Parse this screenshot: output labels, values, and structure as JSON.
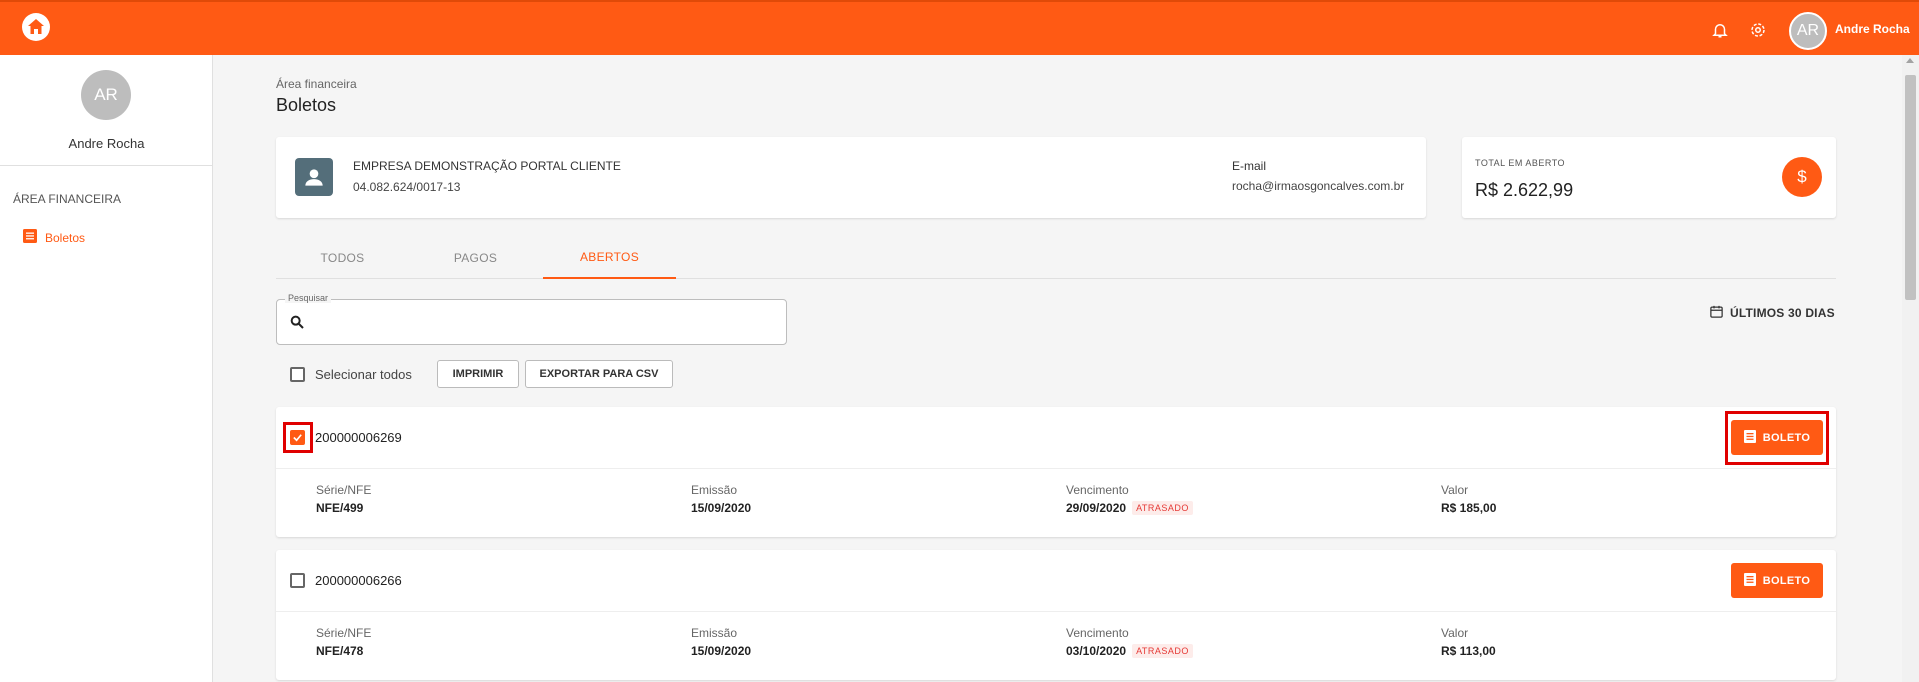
{
  "topbar": {
    "avatar_initials": "AR",
    "user_name": "Andre Rocha",
    "brand_color": "#ff5a14"
  },
  "sidebar": {
    "avatar_initials": "AR",
    "user_name": "Andre Rocha",
    "section": "ÁREA FINANCEIRA",
    "items": [
      {
        "label": "Boletos",
        "icon": "list-icon",
        "active": true
      }
    ]
  },
  "page": {
    "breadcrumb": "Área financeira",
    "title": "Boletos"
  },
  "company": {
    "name": "EMPRESA DEMONSTRAÇÃO PORTAL CLIENTE",
    "cnpj": "04.082.624/0017-13",
    "email_label": "E-mail",
    "email": "rocha@irmaosgoncalves.com.br"
  },
  "total": {
    "label": "TOTAL EM ABERTO",
    "value": "R$ 2.622,99",
    "icon_symbol": "$"
  },
  "tabs": [
    {
      "label": "TODOS",
      "active": false
    },
    {
      "label": "PAGOS",
      "active": false
    },
    {
      "label": "ABERTOS",
      "active": true
    }
  ],
  "search": {
    "label": "Pesquisar",
    "value": "",
    "placeholder": ""
  },
  "date_filter": "ÚLTIMOS 30 DIAS",
  "actions": {
    "select_all": "Selecionar todos",
    "print": "IMPRIMIR",
    "export_csv": "EXPORTAR PARA CSV"
  },
  "boletos": [
    {
      "number": "200000006269",
      "checked": true,
      "button": "BOLETO",
      "serie_label": "Série/NFE",
      "serie": "NFE/499",
      "emissao_label": "Emissão",
      "emissao": "15/09/2020",
      "vencimento_label": "Vencimento",
      "vencimento": "29/09/2020",
      "status": "ATRASADO",
      "valor_label": "Valor",
      "valor": "R$ 185,00"
    },
    {
      "number": "200000006266",
      "checked": false,
      "button": "BOLETO",
      "serie_label": "Série/NFE",
      "serie": "NFE/478",
      "emissao_label": "Emissão",
      "emissao": "15/09/2020",
      "vencimento_label": "Vencimento",
      "vencimento": "03/10/2020",
      "status": "ATRASADO",
      "valor_label": "Valor",
      "valor": "R$ 113,00"
    }
  ]
}
